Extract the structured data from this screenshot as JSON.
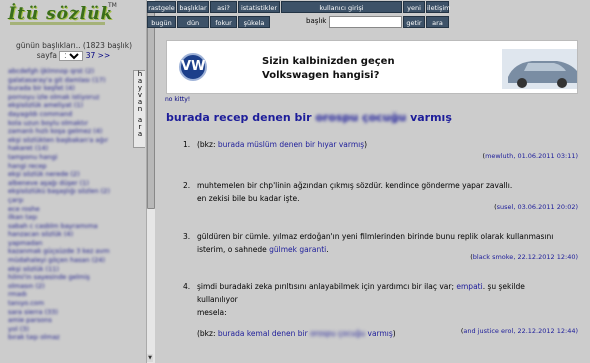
{
  "logo": {
    "text": "İtü sözlük",
    "tm": "TM"
  },
  "left": {
    "day_count": "günün başlıkları.. (1823 başlık)",
    "page_label": "sayfa",
    "page_selected": "1",
    "page_next": "37 >>",
    "tabs": [
      "h",
      "a",
      "y",
      "v",
      "a",
      "n",
      "",
      "a",
      "r",
      "a"
    ],
    "entries": [
      "abcdefgh ijklmnop qrst (2)",
      "galatasaray'a git damlası (17)",
      "burada bir keşfet (4)",
      "pornoyu izle olmak istiyoruz",
      "ekşisözlük ameliyat (1)",
      "dayagıldı command",
      "kola uzun boylu olmaktır",
      "zamanlı hızlı koşa gelmez (4)",
      "ekşi sözlükten başbakan'a ağır",
      "hakaret (14)",
      "tamponu hangi",
      "hangi recep",
      "ekşi sözlük nerede (2)",
      "albeneve aşağı düşer (1)",
      "ekşisözlükü başaşlığı sözlen (2)",
      "çarşı",
      "ece roshe",
      "ilkan taşı",
      "sabah c casblm bayramıma",
      "hanzacan sözlük (4)",
      "yapmadan",
      "kazanmak güçsüzde 3 kez avm",
      "müdahaleyi göçen hasan (24)",
      "ekşi sözlük (11)",
      "hilmi'in sayesinde gelmiş",
      "olmasın (2)",
      "rmadı",
      "tanıyo.com",
      "sara sierra (33)",
      "amie parsons",
      "yol (3)",
      "bırak taşı olmaz"
    ]
  },
  "nav": {
    "row1": [
      "rastgele",
      "başlıklar",
      "asi?",
      "istatistikler",
      "kullanıcı girişi",
      "yeni",
      "iletişim"
    ],
    "row2": [
      "bugün",
      "dün",
      "fokur",
      "şükela",
      "getir",
      "ara"
    ],
    "baslik_label": "başlık",
    "baslik_value": ""
  },
  "ad": {
    "brand_letter": "VW",
    "line1": "Sizin kalbinizden geçen",
    "line2": "Volkswagen hangisi?"
  },
  "no_kitty": "no kitty!",
  "topic": {
    "title_pre": "burada recep denen bir",
    "title_blur": "orospu çocuğu",
    "title_post": "varmış"
  },
  "entries": [
    {
      "num": "1.",
      "text_pre": "(bkz:",
      "link": "burada müslüm denen bir hıyar varmış",
      "text_post": ")",
      "author": "mewluth",
      "date": ", 01.06.2011 03:11)"
    },
    {
      "num": "2.",
      "line1": "muhtemelen bir chp'linin ağzından çıkmış sözdür. kendince gönderme yapar zavallı.",
      "line2": "en zekisi bile bu kadar işte.",
      "author": "susel",
      "date": ", 03.06.2011 20:02)"
    },
    {
      "num": "3.",
      "line1": "güldüren bir cümle. yılmaz erdoğan'ın yeni filmlerinden birinde bunu replik olarak kullanmasını",
      "line2_pre": "isterim, o sahnede",
      "link": "gülmek garanti",
      "line2_post": ".",
      "author": "black smoke",
      "date": ", 22.12.2012 12:40)"
    },
    {
      "num": "4.",
      "line1_pre": "şimdi buradaki zeka pırıltısını anlayabilmek için yardımcı bir ilaç var;",
      "link1": "empati",
      "line1_post": ". şu şekilde kullanılıyor",
      "line2": "mesela:",
      "line3_pre": "(bkz:",
      "link2": "burada kemal denen bir",
      "blur": "orospu çocuğu",
      "link2_post": "varmış",
      "line3_post": ")",
      "author": "and justice erol",
      "date": ", 22.12.2012 12:44)"
    }
  ]
}
